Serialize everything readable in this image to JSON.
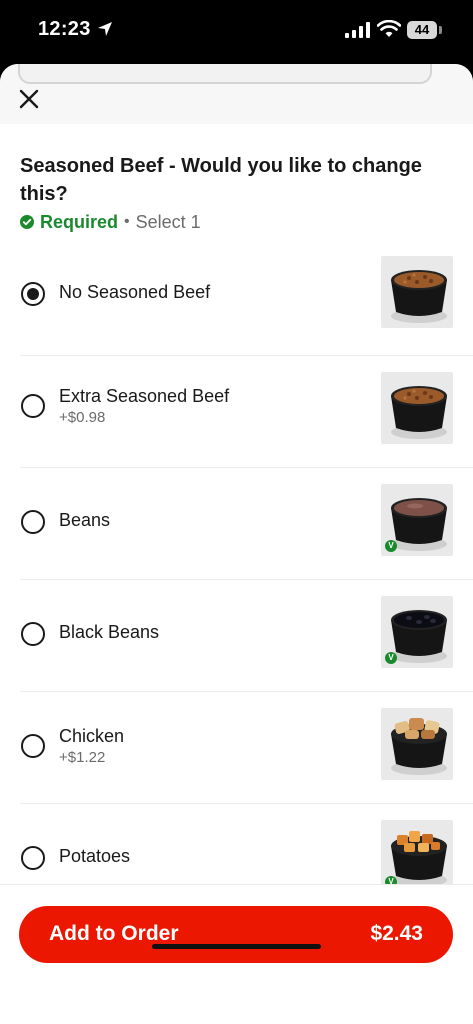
{
  "status_bar": {
    "time": "12:23",
    "battery": "44"
  },
  "header": {
    "title": "Seasoned Beef - Would you like to change this?",
    "required_label": "Required",
    "separator": "•",
    "select_hint": "Select 1"
  },
  "options": [
    {
      "name": "No Seasoned Beef",
      "price": "",
      "selected": true,
      "thumb": "seasoned-beef"
    },
    {
      "name": "Extra Seasoned Beef",
      "price": "+$0.98",
      "selected": false,
      "thumb": "seasoned-beef"
    },
    {
      "name": "Beans",
      "price": "",
      "selected": false,
      "thumb": "refried-beans",
      "vegetarian": true
    },
    {
      "name": "Black Beans",
      "price": "",
      "selected": false,
      "thumb": "black-beans",
      "vegetarian": true
    },
    {
      "name": "Chicken",
      "price": "+$1.22",
      "selected": false,
      "thumb": "chicken"
    },
    {
      "name": "Potatoes",
      "price": "",
      "selected": false,
      "thumb": "potatoes",
      "vegetarian": true
    }
  ],
  "footer": {
    "add_label": "Add to Order",
    "total": "$2.43"
  },
  "colors": {
    "accent": "#eb1700",
    "required": "#1b8a2e",
    "text": "#191919",
    "muted": "#6b6b6b"
  }
}
